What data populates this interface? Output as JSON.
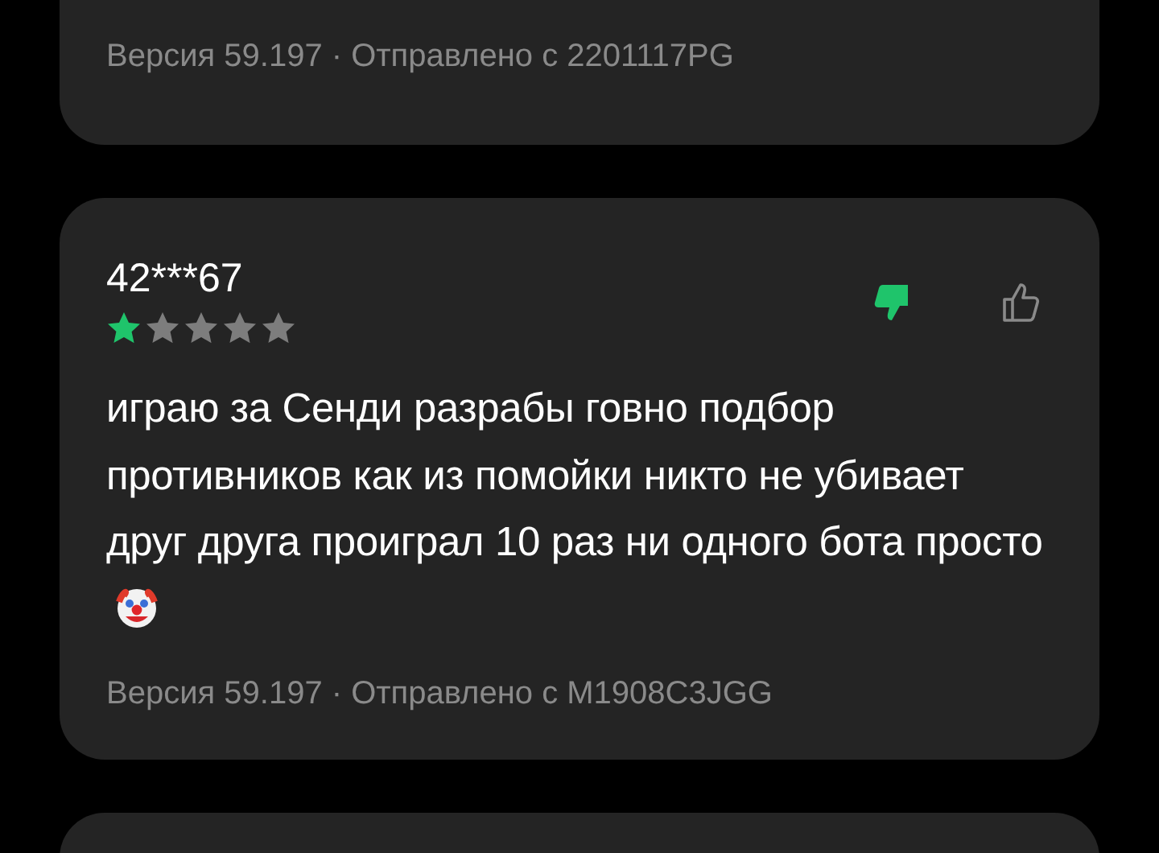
{
  "reviews": [
    {
      "footer": "Версия 59.197 · Отправлено с 2201117PG"
    },
    {
      "author": "42***67",
      "stars": 1,
      "votes": [
        {
          "kind": "dislike",
          "selected": true
        },
        {
          "kind": "like",
          "selected": false
        }
      ],
      "text": "играю за Сенди разрабы говно подбор противников как из помойки никто не убивает друг друга проиграл 10 раз ни одного бота просто",
      "footer": "Версия 59.197 · Отправлено с M1908C3JGG"
    }
  ]
}
